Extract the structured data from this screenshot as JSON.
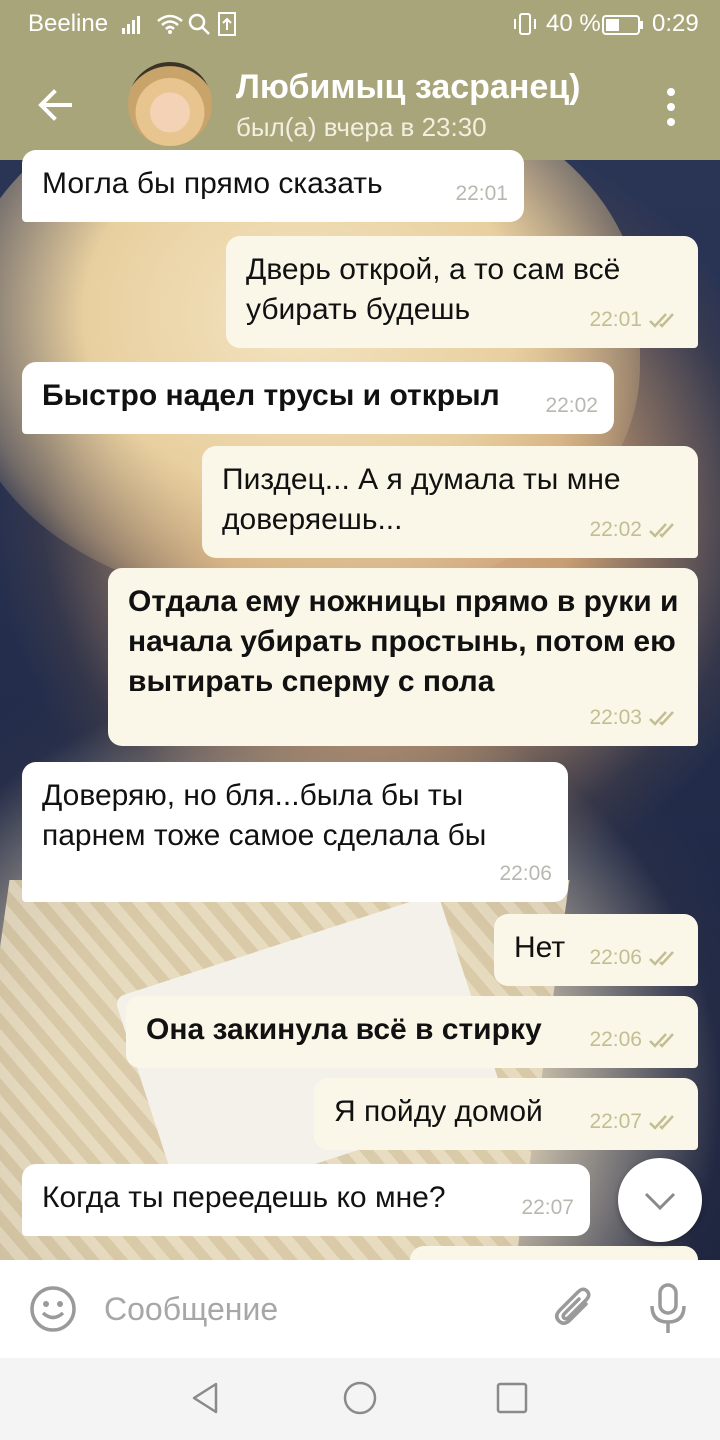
{
  "status_bar": {
    "carrier": "Beeline",
    "battery_percent": "40 %",
    "time": "0:29",
    "icons": [
      "signal-icon",
      "wifi-icon",
      "search-icon",
      "upload-icon",
      "vibrate-icon",
      "battery-icon"
    ]
  },
  "header": {
    "title": "Любимыц засранец)",
    "status": "был(а) вчера в 23:30",
    "icons": [
      "back-arrow-icon",
      "avatar",
      "more-vert-icon"
    ]
  },
  "messages": [
    {
      "direction": "in",
      "bold": false,
      "text": "Могла бы прямо сказать",
      "time": "22:01"
    },
    {
      "direction": "out",
      "bold": false,
      "text": "Дверь открой, а то сам всё убирать будешь",
      "time": "22:01",
      "read": true
    },
    {
      "direction": "in",
      "bold": true,
      "text": "Быстро надел трусы и открыл",
      "time": "22:02"
    },
    {
      "direction": "out",
      "bold": false,
      "text": "Пиздец... А я думала ты мне доверяешь...",
      "time": "22:02",
      "read": true
    },
    {
      "direction": "out",
      "bold": true,
      "text": "Отдала ему ножницы прямо в руки и начала убирать простынь, потом ею вытирать сперму с пола",
      "time": "22:03",
      "read": true
    },
    {
      "direction": "in",
      "bold": false,
      "text": "Доверяю, но бля...была бы ты парнем тоже самое сделала бы",
      "time": "22:06"
    },
    {
      "direction": "out",
      "bold": false,
      "text": "Нет",
      "time": "22:06",
      "read": true
    },
    {
      "direction": "out",
      "bold": true,
      "text": "Она закинула всё в стирку",
      "time": "22:06",
      "read": true
    },
    {
      "direction": "out",
      "bold": false,
      "text": "Я пойду домой",
      "time": "22:07",
      "read": true
    },
    {
      "direction": "in",
      "bold": false,
      "text": "Когда ты переедешь ко мне?",
      "time": "22:07"
    }
  ],
  "input": {
    "placeholder": "Сообщение",
    "icons": [
      "emoji-icon",
      "attach-icon",
      "mic-icon"
    ]
  },
  "navbar": {
    "icons": [
      "nav-back-icon",
      "nav-home-icon",
      "nav-recent-icon"
    ]
  },
  "colors": {
    "header": "#a9a57a",
    "incoming_bubble": "#ffffff",
    "outgoing_bubble": "#fbf7e8",
    "check_marks": "#c2be92"
  }
}
